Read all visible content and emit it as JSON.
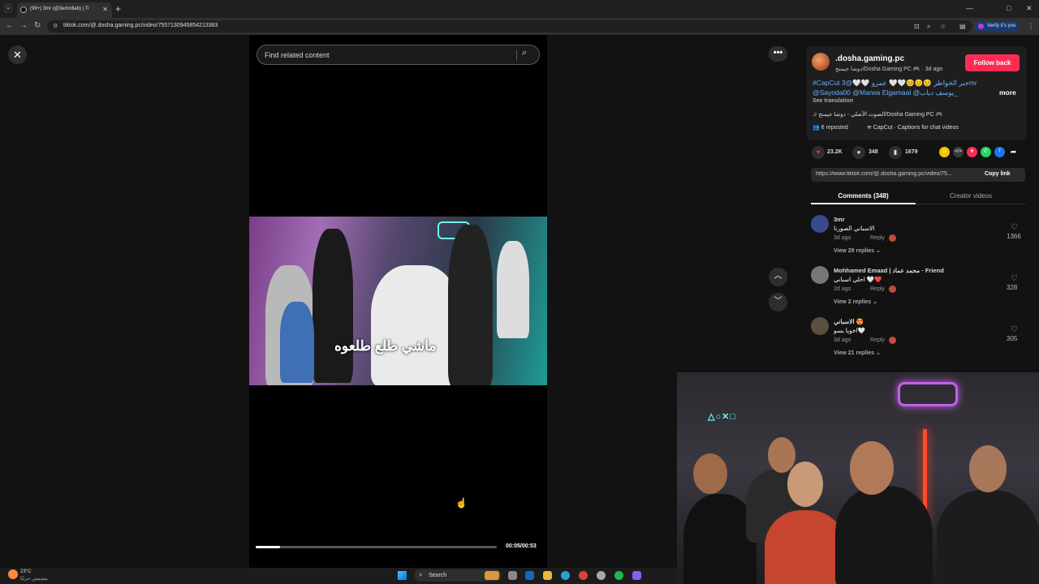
{
  "browser": {
    "tab_title": "(99+) 3mr (@3emrdiab) | Ti",
    "url": "tiktok.com/@.dosha.gaming.pc/video/7557130945854213383",
    "verify_label": "Verify it's you",
    "new_tab_label": "+"
  },
  "player": {
    "search_placeholder": "Find related content",
    "caption": "ماشي طلع طلعوه",
    "timecode": "00:05/00:53",
    "progress_percent": 10
  },
  "post": {
    "author": ".dosha.gaming.pc",
    "subline": "دوشا جيمنج/Dosha Gaming PC 🎮 · 3d ago",
    "follow_label": "Follow back",
    "desc_line1": "#CapCut جبر الخواطر 😊😊😊🤍🤍 عمرو 🤍🤍@3mr",
    "desc_line2": "@Sayoda00 @Marwa Elgamaal @يوسف دياب_",
    "more_label": "more",
    "see_translation": "See translation",
    "sound": "♫  الصوت الأصلي - دوشا جيمنج/Dosha Gaming PC 🎮",
    "reposted": "6 reposted",
    "capcut": "CapCut · Captions for chat videos",
    "likes": "23.2K",
    "comments": "348",
    "saves": "1679",
    "link": "https://www.tiktok.com/@.dosha.gaming.pc/video/75...",
    "copy_link": "Copy link"
  },
  "tabs": {
    "comments": "Comments (348)",
    "creator": "Creator videos"
  },
  "comments": [
    {
      "name": "3mr",
      "text": "الاسباني الصورنا",
      "date": "3d ago",
      "reply": "Reply",
      "view": "View 29 replies ⌄",
      "likes": "1366",
      "avatar_color": "#3a4a8c"
    },
    {
      "name": "Mohhamed Emaad | محمد عماد · Friend",
      "text": "احلي اسباني 🤍❤️",
      "date": "2d ago",
      "reply": "Reply",
      "view": "View 2 replies ⌄",
      "likes": "328",
      "avatar_color": "#777"
    },
    {
      "name": "الاسباني 😍",
      "text": "اخويا يسو🤍",
      "date": "3d ago",
      "reply": "Reply",
      "view": "View 21 replies ⌄",
      "likes": "305",
      "avatar_color": "#5a5040"
    }
  ],
  "taskbar": {
    "temp": "23°C",
    "location": "مشمس جزئيًا",
    "search": "Search"
  }
}
